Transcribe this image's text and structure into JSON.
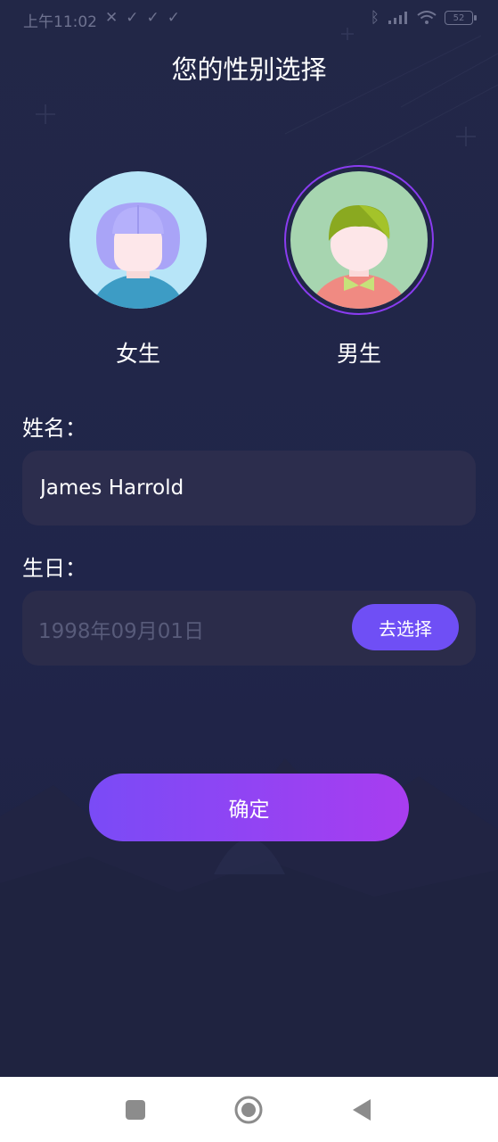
{
  "status_bar": {
    "time": "上午11:02",
    "battery": "52"
  },
  "title": "您的性别选择",
  "gender": {
    "female_label": "女生",
    "male_label": "男生",
    "selected": "男生"
  },
  "form": {
    "name_label": "姓名：",
    "name_value": "James Harrold",
    "birthday_label": "生日：",
    "birthday_value": "1998年09月01日",
    "choose_button": "去选择"
  },
  "confirm_button": "确定",
  "colors": {
    "accent": "#6f4ff5",
    "gradient_start": "#7a4bf6",
    "gradient_end": "#a83df0",
    "background": "#222747"
  },
  "nav": {
    "icons": [
      "recent-apps-icon",
      "home-icon",
      "back-icon"
    ]
  }
}
